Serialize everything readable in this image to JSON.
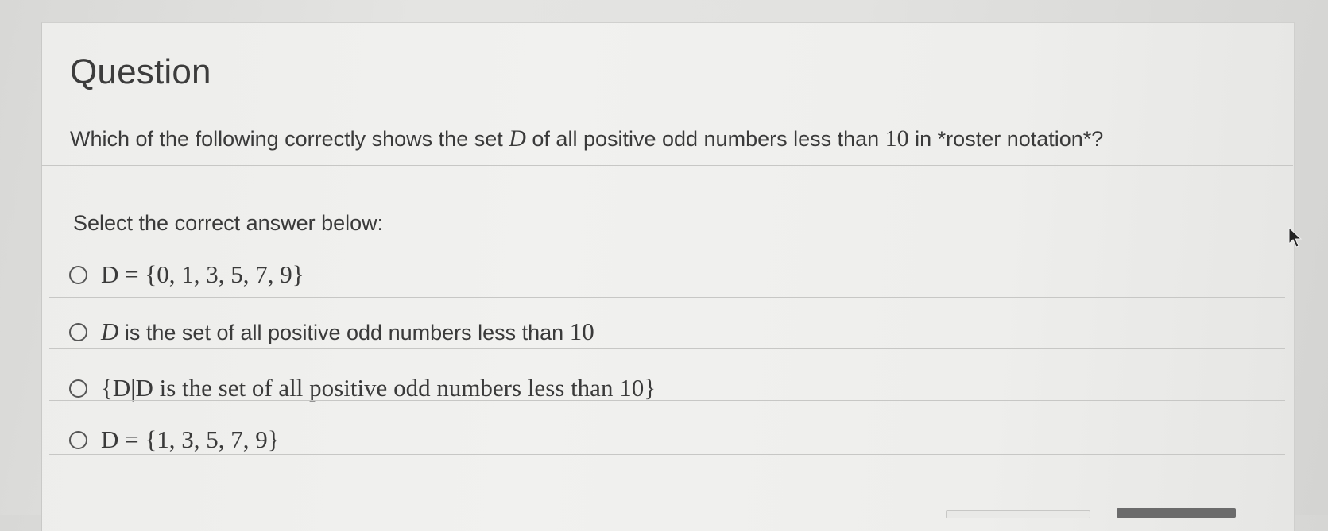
{
  "question": {
    "title": "Question",
    "text_before": "Which of the following correctly shows the set ",
    "set_var": "D",
    "text_middle": " of all positive odd numbers less than ",
    "number": "10",
    "text_after": " in *roster notation*?"
  },
  "instruction": "Select the correct answer below:",
  "options": [
    {
      "math": "D = {0, 1, 3, 5, 7, 9}"
    },
    {
      "var": "D",
      "text": " is the set of all positive odd numbers less than ",
      "num": "10"
    },
    {
      "math": "{D|D is the set of all positive odd numbers less than 10}"
    },
    {
      "math": "D = {1, 3, 5, 7, 9}"
    }
  ],
  "icons": {
    "radio": "radio-button-icon",
    "cursor": "mouse-pointer-icon"
  },
  "colors": {
    "text": "#3a3a3a",
    "divider": "#c7c7c5",
    "card_bg": "#f0f0ee"
  }
}
